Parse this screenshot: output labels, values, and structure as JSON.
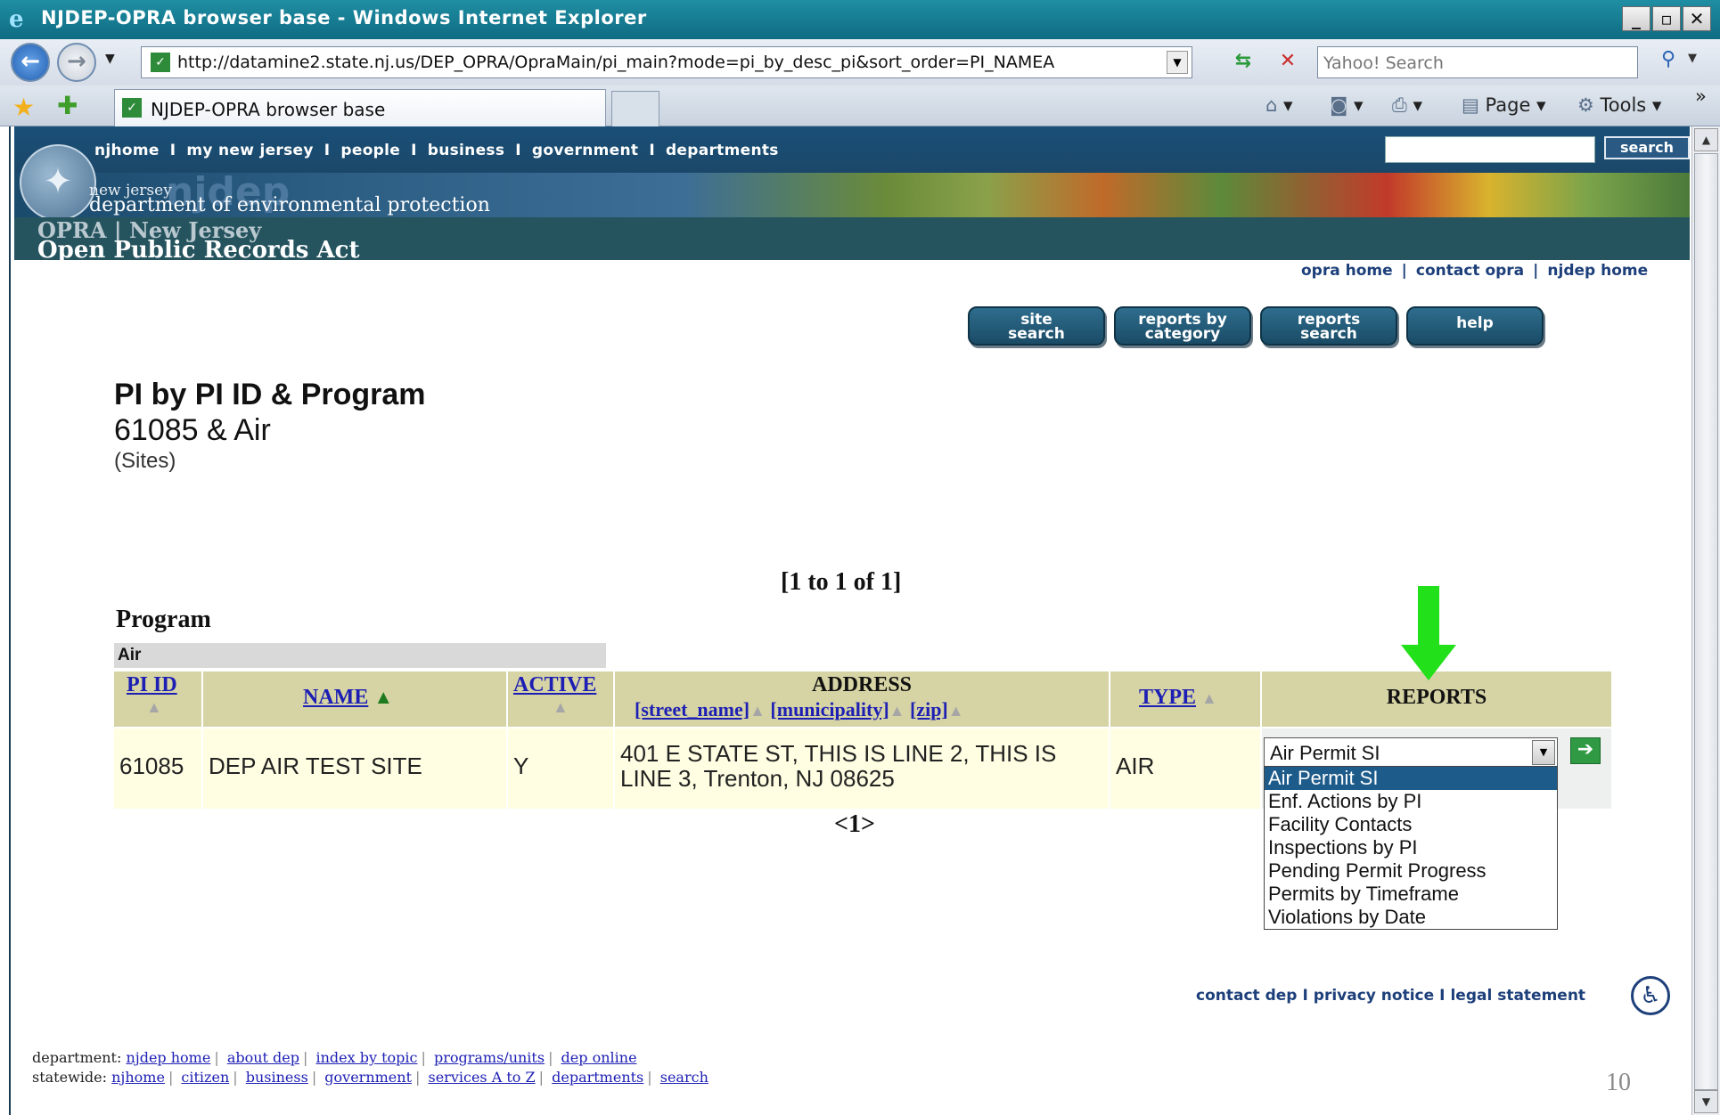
{
  "window": {
    "title": "NJDEP-OPRA browser base - Windows Internet Explorer",
    "controls": [
      "_",
      "▫",
      "✕"
    ]
  },
  "address_bar": {
    "url": "http://datamine2.state.nj.us/DEP_OPRA/OpraMain/pi_main?mode=pi_by_desc_pi&sort_order=PI_NAMEA",
    "search_placeholder": "Yahoo! Search"
  },
  "tab": {
    "label": "NJDEP-OPRA browser base"
  },
  "toolbar": {
    "page_label": "Page",
    "tools_label": "Tools",
    "chevron": "»"
  },
  "site_header": {
    "nav": [
      "njhome",
      "my new jersey",
      "people",
      "business",
      "government",
      "departments"
    ],
    "nav_separator": "I",
    "search_button": "search",
    "newjersey": "new jersey",
    "department": "department of environmental protection",
    "opra_line1": "OPRA | New Jersey",
    "opra_line2": "Open Public Records Act"
  },
  "utility_links": [
    "opra home",
    "contact opra",
    "njdep home"
  ],
  "action_buttons": [
    {
      "line1": "site",
      "line2": "search"
    },
    {
      "line1": "reports by",
      "line2": "category"
    },
    {
      "line1": "reports",
      "line2": "search"
    },
    {
      "line1": "help",
      "line2": ""
    }
  ],
  "page": {
    "heading": "PI by PI ID & Program",
    "subheading": "61085 & Air",
    "sites": "(Sites)",
    "record_count": "[1 to 1 of 1]",
    "program_label": "Program",
    "program_value": "Air",
    "pager": "<1>"
  },
  "table": {
    "headers": {
      "pi_id": "PI ID",
      "name": "NAME",
      "active": "ACTIVE",
      "address": "ADDRESS",
      "street": "[street_name]",
      "municipality": "[municipality]",
      "zip": "[zip]",
      "type": "TYPE",
      "reports": "REPORTS"
    },
    "rows": [
      {
        "pi_id": "61085",
        "name": "DEP AIR TEST SITE",
        "active": "Y",
        "address_line1": "401 E STATE ST, THIS IS LINE 2, THIS IS",
        "address_line2": "LINE 3, Trenton, NJ 08625",
        "type": "AIR"
      }
    ]
  },
  "reports": {
    "selected": "Air Permit SI",
    "options": [
      "Air Permit SI",
      "Enf. Actions by PI",
      "Facility Contacts",
      "Inspections by PI",
      "Pending Permit Progress",
      "Permits by Timeframe",
      "Violations by Date"
    ]
  },
  "footer": {
    "links": [
      "contact dep",
      "privacy notice",
      "legal statement"
    ],
    "department_prefix": "department:",
    "department_links": [
      "njdep home",
      "about dep",
      "index by topic",
      "programs/units",
      "dep online"
    ],
    "statewide_prefix": "statewide:",
    "statewide_links": [
      "njhome",
      "citizen",
      "business",
      "government",
      "services A to Z",
      "departments",
      "search"
    ]
  },
  "slide_number": "10",
  "colors": {
    "title_bar": "#1f8ea3",
    "header_blue": "#1b4a6a",
    "table_header": "#d6d4a4",
    "table_row": "#fffee2",
    "link_blue": "#1d1fb4",
    "arrow_green": "#22e01a"
  }
}
